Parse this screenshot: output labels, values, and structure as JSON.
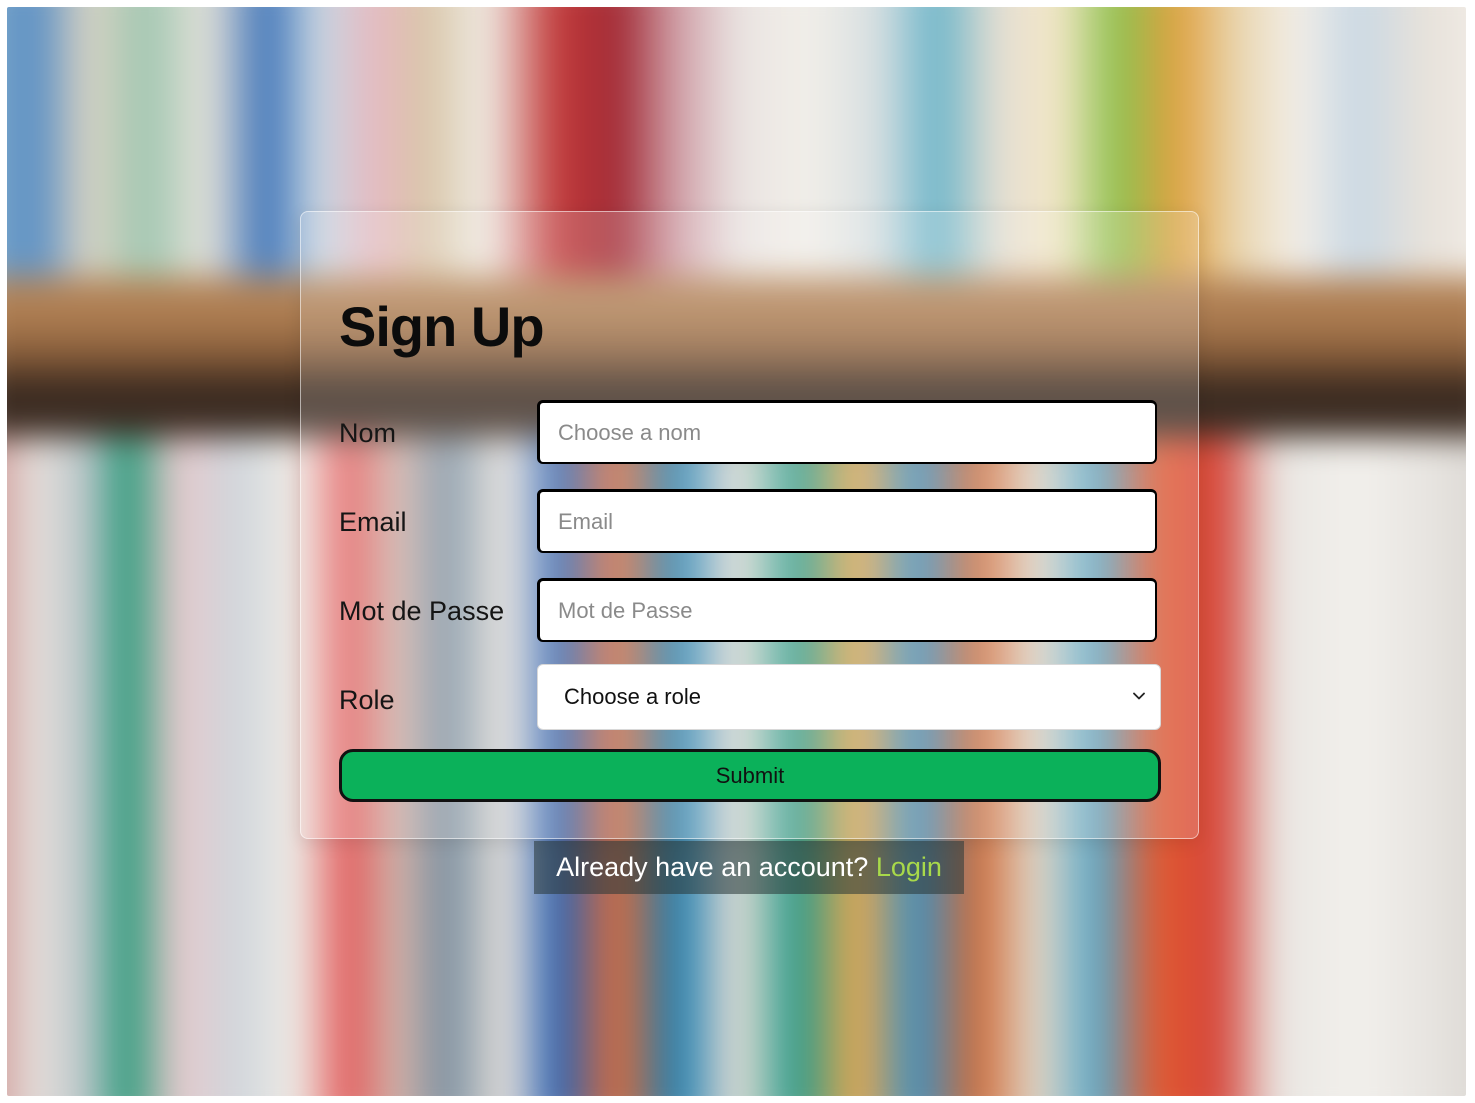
{
  "form": {
    "title": "Sign Up",
    "fields": [
      {
        "label": "Nom",
        "placeholder": "Choose a nom",
        "value": ""
      },
      {
        "label": "Email",
        "placeholder": "Email",
        "value": ""
      },
      {
        "label": "Mot de Passe",
        "placeholder": "Mot de Passe",
        "value": ""
      }
    ],
    "role": {
      "label": "Role",
      "selected": "Choose a role"
    },
    "submit_label": "Submit"
  },
  "footer": {
    "prompt": "Already have an account?",
    "login_label": "Login"
  },
  "colors": {
    "submit_bg": "#0bb15a",
    "login_link": "#a8d94a"
  },
  "icons": {
    "select_chevron": "chevron-down-icon"
  }
}
